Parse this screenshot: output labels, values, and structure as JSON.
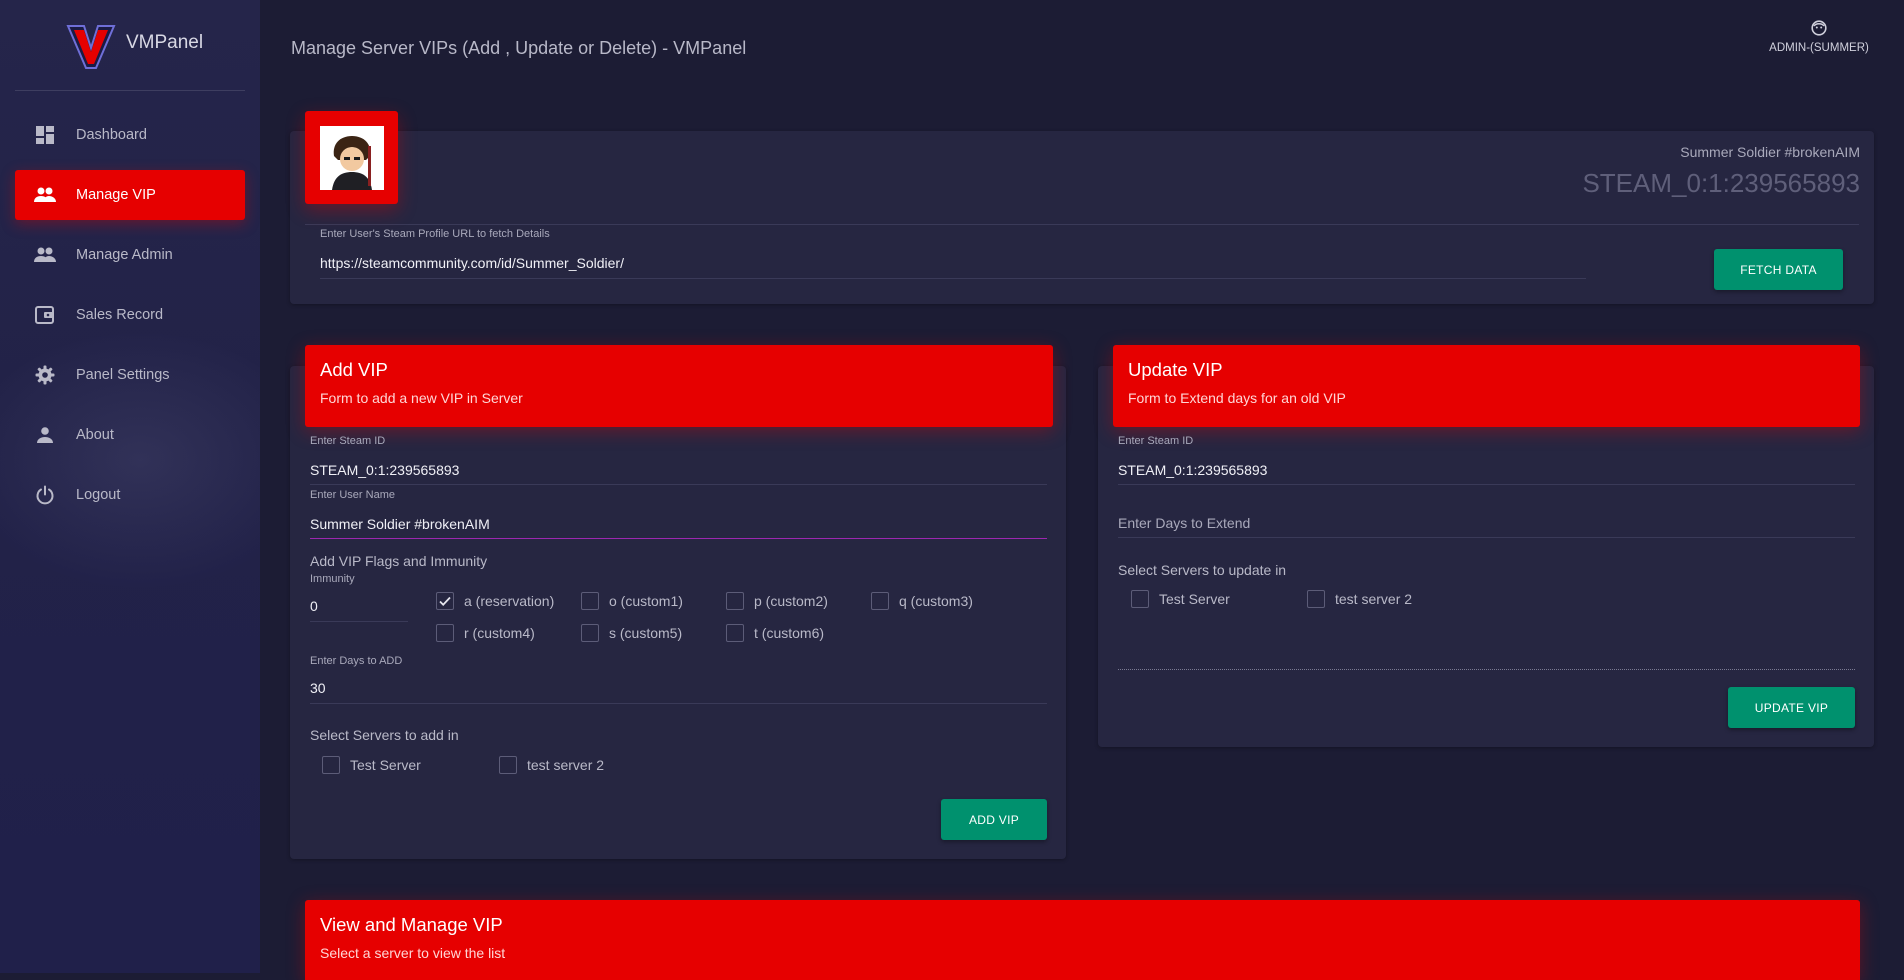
{
  "app": {
    "name": "VMPanel",
    "page_title": "Manage Server VIPs (Add , Update or Delete) - VMPanel",
    "user_label": "ADMIN-(SUMMER)"
  },
  "sidebar": {
    "items": [
      {
        "label": "Dashboard",
        "icon": "dashboard-icon"
      },
      {
        "label": "Manage VIP",
        "icon": "people-icon",
        "active": true
      },
      {
        "label": "Manage Admin",
        "icon": "people-icon"
      },
      {
        "label": "Sales Record",
        "icon": "wallet-icon"
      },
      {
        "label": "Panel Settings",
        "icon": "gear-icon"
      },
      {
        "label": "About",
        "icon": "person-icon"
      },
      {
        "label": "Logout",
        "icon": "power-icon"
      }
    ]
  },
  "profile": {
    "display_name": "Summer Soldier #brokenAIM",
    "steam_id": "STEAM_0:1:239565893",
    "url_label": "Enter User's Steam Profile URL to fetch Details",
    "url_value": "https://steamcommunity.com/id/Summer_Soldier/",
    "fetch_button": "FETCH DATA"
  },
  "add_vip": {
    "title": "Add VIP",
    "subtitle": "Form to add a new VIP in Server",
    "steam_id_label": "Enter Steam ID",
    "steam_id_value": "STEAM_0:1:239565893",
    "user_name_label": "Enter User Name",
    "user_name_value": "Summer Soldier #brokenAIM",
    "flags_heading": "Add VIP Flags and Immunity",
    "immunity_label": "Immunity",
    "immunity_value": "0",
    "flags": [
      {
        "label": "a (reservation)",
        "checked": true
      },
      {
        "label": "o (custom1)",
        "checked": false
      },
      {
        "label": "p (custom2)",
        "checked": false
      },
      {
        "label": "q (custom3)",
        "checked": false
      },
      {
        "label": "r (custom4)",
        "checked": false
      },
      {
        "label": "s (custom5)",
        "checked": false
      },
      {
        "label": "t (custom6)",
        "checked": false
      }
    ],
    "days_label": "Enter Days to ADD",
    "days_value": "30",
    "servers_heading": "Select Servers to add in",
    "servers": [
      {
        "label": "Test Server",
        "checked": false
      },
      {
        "label": "test server 2",
        "checked": false
      }
    ],
    "submit_button": "ADD VIP"
  },
  "update_vip": {
    "title": "Update VIP",
    "subtitle": "Form to Extend days for an old VIP",
    "steam_id_label": "Enter Steam ID",
    "steam_id_value": "STEAM_0:1:239565893",
    "days_placeholder": "Enter Days to Extend",
    "servers_heading": "Select Servers to update in",
    "servers": [
      {
        "label": "Test Server",
        "checked": false
      },
      {
        "label": "test server 2",
        "checked": false
      }
    ],
    "submit_button": "UPDATE VIP"
  },
  "view_vip": {
    "title": "View and Manage VIP",
    "subtitle": "Select a server to view the list"
  },
  "colors": {
    "accent_red": "#e60000",
    "button_green": "#00916e",
    "background": "#1c1c34",
    "card": "#262641",
    "focus_purple": "#9c27b0"
  }
}
